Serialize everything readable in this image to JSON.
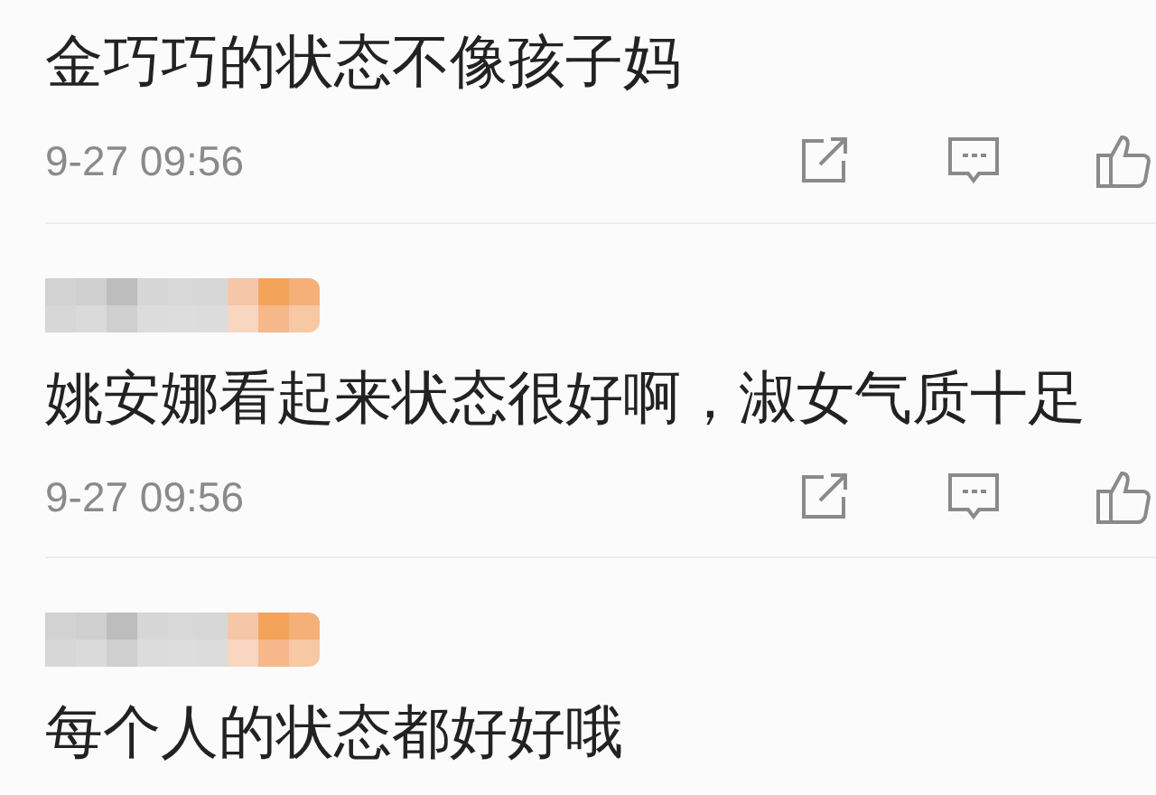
{
  "comments": [
    {
      "name_hidden": false,
      "text": "金巧巧的状态不像孩子妈",
      "time": "9-27 09:56"
    },
    {
      "name_hidden": true,
      "text": "姚安娜看起来状态很好啊，淑女气质十足",
      "time": "9-27 09:56"
    },
    {
      "name_hidden": true,
      "text": "每个人的状态都好好哦"
    }
  ]
}
